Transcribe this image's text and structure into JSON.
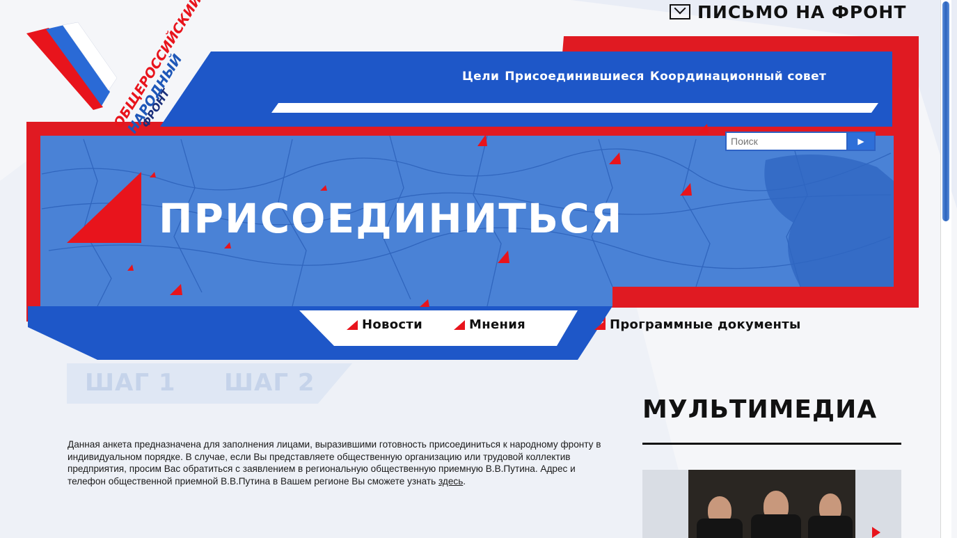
{
  "logo": {
    "line1": "ОБЩЕРОССИЙСКИЙ",
    "line2": "НАРОДНЫЙ",
    "line3": "ФРОНТ"
  },
  "letter_to_front": "ПИСЬМО НА ФРОНТ",
  "top_nav": {
    "items": [
      "Цели",
      "Присоединившиеся",
      "Координационный совет"
    ]
  },
  "search": {
    "placeholder": "Поиск"
  },
  "banner": {
    "title": "ПРИСОЕДИНИТЬСЯ"
  },
  "sub_nav": {
    "items": [
      "Новости",
      "Мнения",
      "Программные документы"
    ]
  },
  "steps": [
    "ШАГ 1",
    "ШАГ 2"
  ],
  "multimedia": {
    "title": "МУЛЬТИМЕДИА"
  },
  "intro": {
    "text": "Данная анкета предназначена для заполнения лицами, выразившими готовность присоединиться к народному фронту в индивидуальном порядке. В случае, если Вы представляете общественную организацию или трудовой коллектив предприятия, просим Вас обратиться с заявлением в региональную общественную приемную В.В.Путина. Адрес и телефон общественной приемной В.В.Путина в Вашем регионе Вы сможете узнать ",
    "link": "здесь",
    "end": "."
  },
  "colors": {
    "blue": "#1e57c8",
    "map_blue": "#4a82d6",
    "red": "#e8141c"
  }
}
